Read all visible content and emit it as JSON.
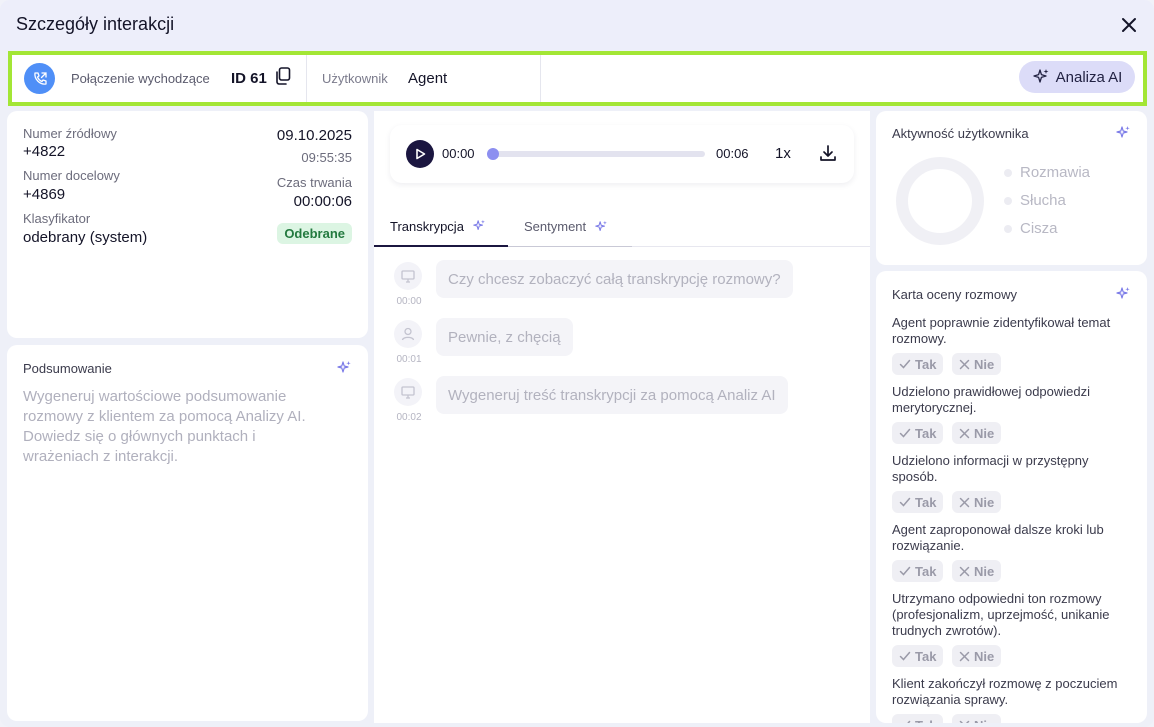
{
  "window": {
    "title": "Szczegóły interakcji"
  },
  "header": {
    "call_type": "Połączenie wychodzące",
    "call_id": "ID 61",
    "user_label": "Użytkownik",
    "user_value": "Agent",
    "ai_button": "Analiza AI"
  },
  "details": {
    "source_label": "Numer źródłowy",
    "source_value": "+4822",
    "date": "09.10.2025",
    "time": "09:55:35",
    "target_label": "Numer docelowy",
    "target_value": "+4869",
    "duration_label": "Czas trwania",
    "duration_value": "00:00:06",
    "classifier_label": "Klasyfikator",
    "classifier_value": "odebrany (system)",
    "status_badge": "Odebrane"
  },
  "summary": {
    "title": "Podsumowanie",
    "text": "Wygeneruj wartościowe podsumowanie rozmowy z klientem za pomocą Analizy AI. Dowiedz się o głównych punktach i wrażeniach z interakcji."
  },
  "player": {
    "current": "00:00",
    "end": "00:06",
    "speed": "1x",
    "progress": 0
  },
  "tabs": [
    {
      "label": "Transkrypcja"
    },
    {
      "label": "Sentyment"
    }
  ],
  "transcript": [
    {
      "time": "00:00",
      "speaker_icon": "monitor-icon",
      "text": "Czy chcesz zobaczyć całą transkrypcję rozmowy?"
    },
    {
      "time": "00:01",
      "speaker_icon": "user-icon",
      "text": "Pewnie, z chęcią"
    },
    {
      "time": "00:02",
      "speaker_icon": "monitor-icon",
      "text": "Wygeneruj treść transkrypcji za pomocą Analiz AI"
    }
  ],
  "activity": {
    "title": "Aktywność użytkownika",
    "legend": [
      {
        "label": "Rozmawia"
      },
      {
        "label": "Słucha"
      },
      {
        "label": "Cisza"
      }
    ]
  },
  "scorecard": {
    "title": "Karta oceny rozmowy",
    "yes_label": "Tak",
    "no_label": "Nie",
    "questions": [
      {
        "text": "Agent poprawnie zidentyfikował temat rozmowy."
      },
      {
        "text": "Udzielono prawidłowej odpowiedzi merytorycznej."
      },
      {
        "text": "Udzielono informacji w przystępny sposób."
      },
      {
        "text": "Agent zaproponował dalsze kroki lub rozwiązanie."
      },
      {
        "text": "Utrzymano odpowiedni ton rozmowy (profesjonalizm, uprzejmość, unikanie trudnych zwrotów)."
      },
      {
        "text": "Klient zakończył rozmowę z poczuciem rozwiązania sprawy."
      }
    ]
  },
  "colors": {
    "accent": "#a3e635",
    "primary": "#1b1640",
    "call_icon": "#4f8ff7",
    "success": "#237a3f"
  }
}
